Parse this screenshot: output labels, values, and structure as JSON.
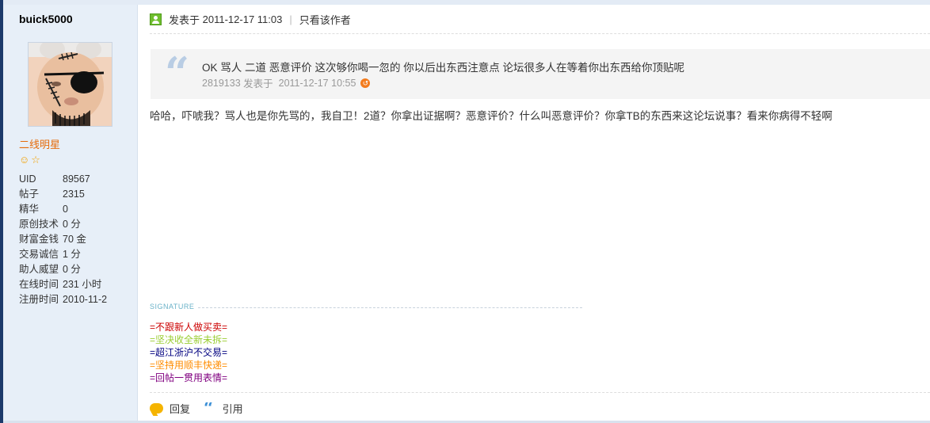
{
  "user": {
    "username": "buick5000",
    "rank": "二线明星",
    "stats": [
      {
        "label": "UID",
        "value": "89567"
      },
      {
        "label": "帖子",
        "value": "2315"
      },
      {
        "label": "精华",
        "value": "0"
      },
      {
        "label": "原创技术",
        "value": "0 分"
      },
      {
        "label": "财富金钱",
        "value": "70 金"
      },
      {
        "label": "交易诚信",
        "value": "1 分"
      },
      {
        "label": "助人威望",
        "value": "0 分"
      },
      {
        "label": "在线时间",
        "value": "231 小时"
      },
      {
        "label": "注册时间",
        "value": "2010-11-2"
      }
    ]
  },
  "post": {
    "posted_label": "发表于",
    "posted_time": "2011-12-17 11:03",
    "separator": "|",
    "only_author": "只看该作者",
    "quote": {
      "text": "OK  骂人  二道  恶意评价  这次够你喝一忽的    你以后出东西注意点  论坛很多人在等着你出东西给你顶贴呢",
      "meta_id": "2819133",
      "meta_label": "发表于",
      "meta_time": "2011-12-17 10:55"
    },
    "body": "哈哈，吓唬我？骂人也是你先骂的，我自卫！2道？你拿出证据啊？恶意评价？什么叫恶意评价？你拿TB的东西来这论坛说事？看来你病得不轻啊",
    "signature_label": "SIGNATURE",
    "signature_lines": [
      {
        "text": "=不跟新人做买卖=",
        "color": "#cc0000"
      },
      {
        "text": "=坚决收全新未拆=",
        "color": "#9acd32"
      },
      {
        "text": "=超江浙沪不交易=",
        "color": "#000080"
      },
      {
        "text": "=坚持用顺丰快递=",
        "color": "#ff8c00"
      },
      {
        "text": "=回帖一贯用表情=",
        "color": "#800080"
      }
    ]
  },
  "actions": {
    "reply": "回复",
    "quote": "引用"
  }
}
